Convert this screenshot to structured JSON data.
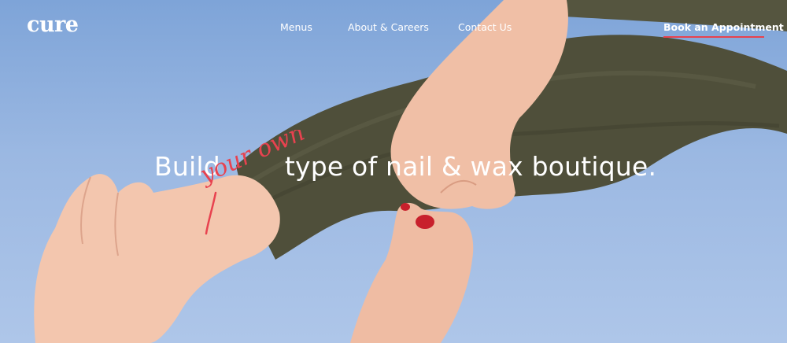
{
  "header": {
    "logo": "cure",
    "nav": {
      "menus": "Menus",
      "about": "About & Careers",
      "contact": "Contact Us"
    },
    "cta_label": "Book an Appointment"
  },
  "hero": {
    "headline_lead": "Build",
    "headline_script": "your own",
    "headline_rest": "type of nail & wax boutique."
  },
  "colors": {
    "accent": "#e8424f",
    "sky": "#9bb8e2",
    "fabric": "#4f4f3a",
    "skin": "#f3c6ae"
  }
}
